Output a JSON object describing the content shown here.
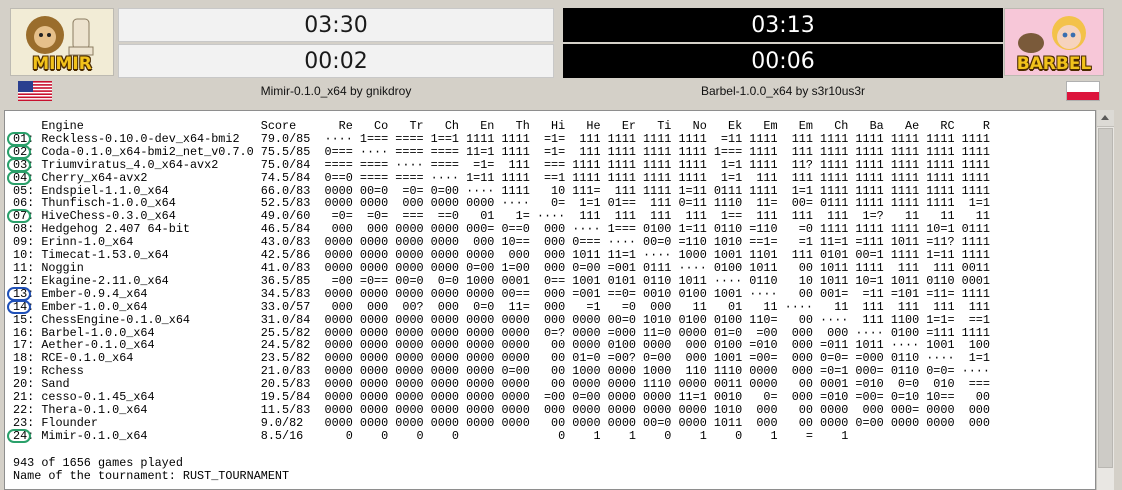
{
  "players": {
    "left": {
      "avatar_name": "MIMIR",
      "total_time": "03:30",
      "move_time": "00:02",
      "engine_label": "Mimir-0.1.0_x64 by gnikdroy",
      "flag_icon": "usa-flag-icon"
    },
    "right": {
      "avatar_name": "BARBEL",
      "total_time": "03:13",
      "move_time": "00:06",
      "engine_label": "Barbel-1.0.0_x64 by s3r10us3r",
      "flag_icon": "poland-flag-icon"
    }
  },
  "colors": {
    "clock_active_bg": "#000000",
    "clock_inactive_bg": "#f2f2f2",
    "mark_green": "#2aa06a",
    "mark_blue": "#1f50b8"
  },
  "crosstable": {
    "columns": [
      "Engine",
      "Score",
      "Re",
      "Co",
      "Tr",
      "Ch",
      "En",
      "Th",
      "Hi",
      "He",
      "Er",
      "Ti",
      "No",
      "Ek",
      "Em",
      "Em",
      "Ch",
      "Ba",
      "Ae",
      "RC",
      "R"
    ],
    "rows": [
      {
        "rank": "01",
        "engine": "Reckless-0.10.0-dev_x64-bmi2",
        "score": "79.0/85",
        "results": [
          "····",
          "1===",
          "====",
          "1==1",
          "1111",
          "1111",
          "=1=",
          "111",
          "1111",
          "1111",
          "1111",
          "=11",
          "1111",
          "111",
          "1111",
          "1111",
          "1111",
          "1111",
          "1111"
        ]
      },
      {
        "rank": "02",
        "engine": "Coda-0.1.0_x64-bmi2_net_v0.7.0",
        "score": "75.5/85",
        "results": [
          "0===",
          "····",
          "====",
          "====",
          "11=1",
          "1111",
          "=1=",
          "111",
          "1111",
          "1111",
          "1111",
          "1===",
          "1111",
          "111",
          "1111",
          "1111",
          "1111",
          "1111",
          "1111"
        ]
      },
      {
        "rank": "03",
        "engine": "Triumviratus_4.0_x64-avx2",
        "score": "75.0/84",
        "results": [
          "====",
          "====",
          "····",
          "====",
          "=1=",
          "111",
          "===",
          "1111",
          "1111",
          "1111",
          "1111",
          "1=1",
          "1111",
          "11?",
          "1111",
          "1111",
          "1111",
          "1111",
          "1111"
        ]
      },
      {
        "rank": "04",
        "engine": "Cherry_x64-avx2",
        "score": "74.5/84",
        "results": [
          "0==0",
          "====",
          "====",
          "····",
          "1=11",
          "1111",
          "==1",
          "1111",
          "1111",
          "1111",
          "1111",
          "1=1",
          "111",
          "111",
          "1111",
          "1111",
          "1111",
          "1111",
          "1111"
        ]
      },
      {
        "rank": "05",
        "engine": "Endspiel-1.1.0_x64",
        "score": "66.0/83",
        "results": [
          "0000",
          "00=0",
          "=0=",
          "0=00",
          "····",
          "1111",
          "10",
          "111=",
          "111",
          "1111",
          "1=11",
          "0111",
          "1111",
          "1=1",
          "1111",
          "1111",
          "1111",
          "1111",
          "1111"
        ]
      },
      {
        "rank": "06",
        "engine": "Thunfisch-1.0.0_x64",
        "score": "52.5/83",
        "results": [
          "0000",
          "0000",
          "000",
          "0000",
          "0000",
          "····",
          "0=",
          "1=1",
          "01==",
          "111",
          "0=11",
          "1110",
          "11=",
          "00=",
          "0111",
          "1111",
          "1111",
          "1111",
          "1=1"
        ]
      },
      {
        "rank": "07",
        "engine": "HiveChess-0.3.0_x64",
        "score": "49.0/60",
        "results": [
          "=0=",
          "=0=",
          "===",
          "==0",
          "01",
          "1=",
          "····",
          "111",
          "111",
          "111",
          "111",
          "1==",
          "111",
          "111",
          "111",
          "1=?",
          "11",
          "11",
          "11"
        ]
      },
      {
        "rank": "08",
        "engine": "Hedgehog 2.407 64-bit",
        "score": "46.5/84",
        "results": [
          "000",
          "000",
          "0000",
          "0000",
          "000=",
          "0==0",
          "000",
          "····",
          "1===",
          "0100",
          "1=11",
          "0110",
          "=110",
          "=0",
          "1111",
          "1111",
          "1111",
          "10=1",
          "0111"
        ]
      },
      {
        "rank": "09",
        "engine": "Erinn-1.0_x64",
        "score": "43.0/83",
        "results": [
          "0000",
          "0000",
          "0000",
          "0000",
          "000",
          "10==",
          "000",
          "0===",
          "····",
          "00=0",
          "=110",
          "1010",
          "==1=",
          "=1",
          "11=1",
          "=111",
          "1011",
          "=11?",
          "1111"
        ]
      },
      {
        "rank": "10",
        "engine": "Timecat-1.53.0_x64",
        "score": "42.5/86",
        "results": [
          "0000",
          "0000",
          "0000",
          "0000",
          "0000",
          "000",
          "000",
          "1011",
          "11=1",
          "····",
          "1000",
          "1001",
          "1101",
          "111",
          "0101",
          "00=1",
          "1111",
          "1=11",
          "1111"
        ]
      },
      {
        "rank": "11",
        "engine": "Noggin",
        "score": "41.0/83",
        "results": [
          "0000",
          "0000",
          "0000",
          "0000",
          "0=00",
          "1=00",
          "000",
          "0=00",
          "=001",
          "0111",
          "····",
          "0100",
          "1011",
          "00",
          "1011",
          "1111",
          "111",
          "111",
          "0011"
        ]
      },
      {
        "rank": "12",
        "engine": "Ekagine-2.11.0_x64",
        "score": "36.5/85",
        "results": [
          "=00",
          "=0==",
          "00=0",
          "0=0",
          "1000",
          "0001",
          "0==",
          "1001",
          "0101",
          "0110",
          "1011",
          "····",
          "0110",
          "10",
          "1011",
          "10=1",
          "1011",
          "0110",
          "0001"
        ]
      },
      {
        "rank": "13",
        "engine": "Ember-0.9.4_x64",
        "score": "34.5/83",
        "results": [
          "0000",
          "0000",
          "0000",
          "0000",
          "0000",
          "00==",
          "000",
          "=001",
          "==0=",
          "0010",
          "0100",
          "1001",
          "····",
          "00",
          "001=",
          "=11",
          "=101",
          "=11=",
          "1111"
        ]
      },
      {
        "rank": "14",
        "engine": "Ember-1.0.0_x64",
        "score": "33.0/57",
        "results": [
          "000",
          "000",
          "00?",
          "000",
          "0=0",
          "11=",
          "000",
          "=1",
          "=0",
          "000",
          "11",
          "01",
          "11",
          "····",
          "11",
          "111",
          "111",
          "111",
          "111"
        ]
      },
      {
        "rank": "15",
        "engine": "ChessEngine-0.1.0_x64",
        "score": "31.0/84",
        "results": [
          "0000",
          "0000",
          "0000",
          "0000",
          "0000",
          "0000",
          "000",
          "0000",
          "00=0",
          "1010",
          "0100",
          "0100",
          "110=",
          "00",
          "····",
          "111",
          "1100",
          "1=1=",
          "==1"
        ]
      },
      {
        "rank": "16",
        "engine": "Barbel-1.0.0_x64",
        "score": "25.5/82",
        "results": [
          "0000",
          "0000",
          "0000",
          "0000",
          "0000",
          "0000",
          "0=?",
          "0000",
          "=000",
          "11=0",
          "0000",
          "01=0",
          "=00",
          "000",
          "000",
          "····",
          "0100",
          "=111",
          "1111"
        ]
      },
      {
        "rank": "17",
        "engine": "Aether-0.1.0_x64",
        "score": "24.5/82",
        "results": [
          "0000",
          "0000",
          "0000",
          "0000",
          "0000",
          "0000",
          "00",
          "0000",
          "0100",
          "0000",
          "000",
          "0100",
          "=010",
          "000",
          "=011",
          "1011",
          "····",
          "1001",
          "100"
        ]
      },
      {
        "rank": "18",
        "engine": "RCE-0.1.0_x64",
        "score": "23.5/82",
        "results": [
          "0000",
          "0000",
          "0000",
          "0000",
          "0000",
          "0000",
          "00",
          "01=0",
          "=00?",
          "0=00",
          "000",
          "1001",
          "=00=",
          "000",
          "0=0=",
          "=000",
          "0110",
          "····",
          "1=1"
        ]
      },
      {
        "rank": "19",
        "engine": "Rchess",
        "score": "21.0/83",
        "results": [
          "0000",
          "0000",
          "0000",
          "0000",
          "0000",
          "0=00",
          "00",
          "1000",
          "0000",
          "1000",
          "110",
          "1110",
          "0000",
          "000",
          "=0=1",
          "000=",
          "0110",
          "0=0=",
          "····"
        ]
      },
      {
        "rank": "20",
        "engine": "Sand",
        "score": "20.5/83",
        "results": [
          "0000",
          "0000",
          "0000",
          "0000",
          "0000",
          "0000",
          "00",
          "0000",
          "0000",
          "1110",
          "0000",
          "0011",
          "0000",
          "00",
          "0001",
          "=010",
          "0=0",
          "010",
          "==="
        ]
      },
      {
        "rank": "21",
        "engine": "cesso-0.1.45_x64",
        "score": "19.5/84",
        "results": [
          "0000",
          "0000",
          "0000",
          "0000",
          "0000",
          "0000",
          "=00",
          "0=00",
          "0000",
          "0000",
          "11=1",
          "0010",
          "0=",
          "000",
          "=010",
          "=00=",
          "0=10",
          "10==",
          "00"
        ]
      },
      {
        "rank": "22",
        "engine": "Thera-0.1.0_x64",
        "score": "11.5/83",
        "results": [
          "0000",
          "0000",
          "0000",
          "0000",
          "0000",
          "0000",
          "000",
          "0000",
          "0000",
          "0000",
          "0000",
          "1010",
          "000",
          "00",
          "0000",
          "000",
          "000=",
          "0000",
          "000"
        ]
      },
      {
        "rank": "23",
        "engine": "Flounder",
        "score": "9.0/82",
        "results": [
          "0000",
          "0000",
          "0000",
          "0000",
          "0000",
          "0000",
          "00",
          "0000",
          "0000",
          "00=0",
          "0000",
          "1011",
          "000",
          "00",
          "0000",
          "0=00",
          "0000",
          "0000",
          "000"
        ]
      },
      {
        "rank": "24",
        "engine": "Mimir-0.1.0_x64",
        "score": "8.5/16",
        "results": [
          "0",
          "0",
          "0",
          "0",
          "",
          "",
          "0",
          "1",
          "1",
          "0",
          "1",
          "0",
          "1",
          "=",
          "1",
          "",
          "",
          "",
          ""
        ]
      }
    ],
    "marked_green_ranks": [
      "01",
      "02",
      "03",
      "04",
      "07",
      "24"
    ],
    "marked_blue_ranks": [
      "13",
      "14"
    ]
  },
  "footer": {
    "games_played": "943 of 1656 games played",
    "tournament_name": "Name of the tournament: RUST_TOURNAMENT"
  }
}
